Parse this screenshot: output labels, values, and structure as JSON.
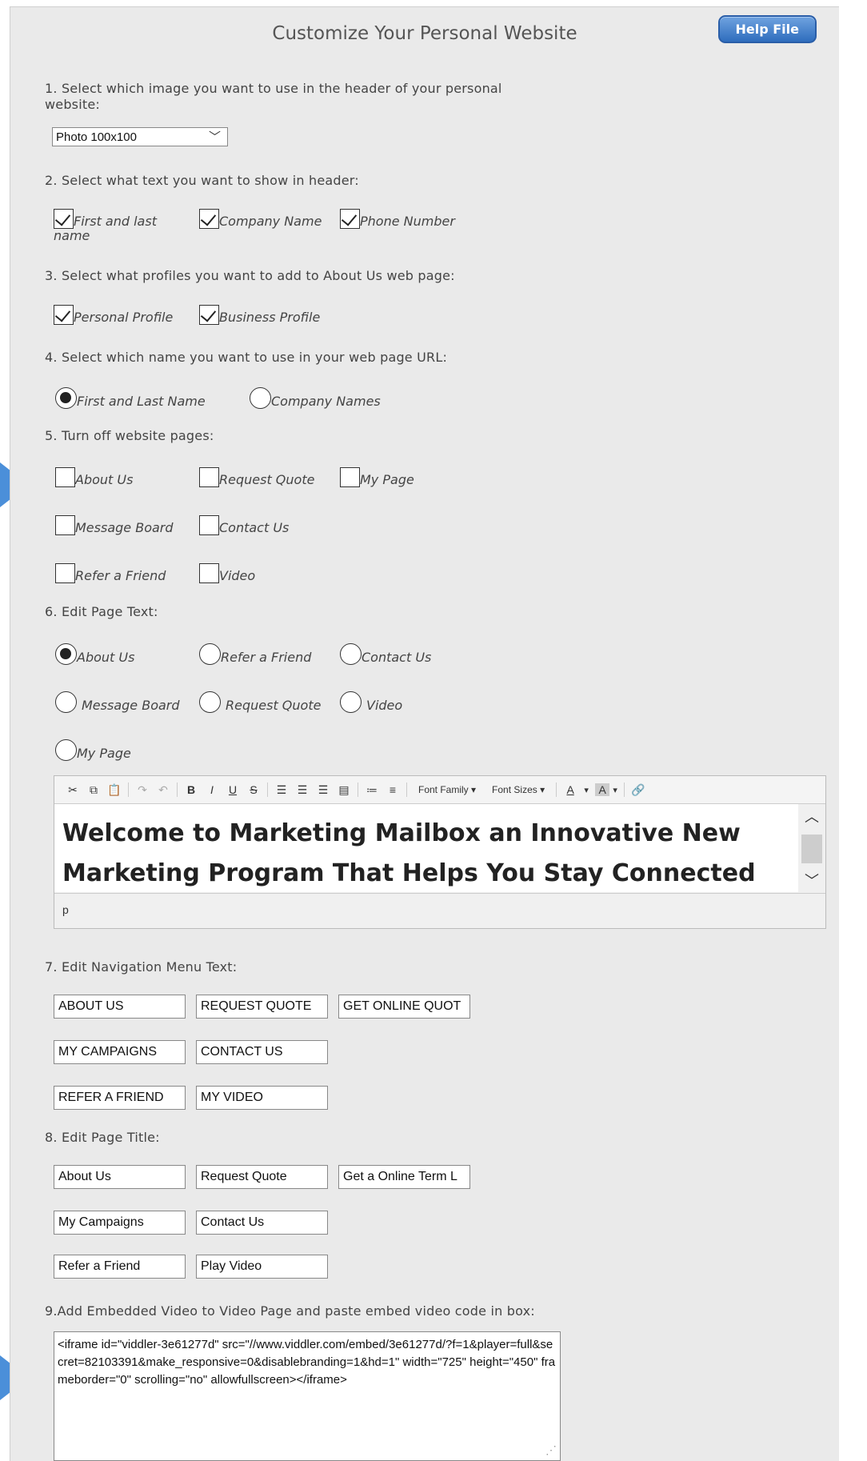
{
  "page": {
    "title": "Customize Your Personal Website",
    "help_label": "Help File"
  },
  "sections": {
    "s1": "1. Select which image you want to use in the header of your personal website:",
    "s2": "2. Select what text you want to show in header:",
    "s3": "3. Select what profiles you want to add to About Us web page:",
    "s4": "4. Select which name you want to use in your web page URL:",
    "s5": "5. Turn off website pages:",
    "s6": "6. Edit Page Text:",
    "s7": "7. Edit Navigation Menu Text:",
    "s8": "8. Edit Page Title:",
    "s9": "9.Add Embedded Video to Video Page and paste embed video code in box:"
  },
  "header_image": {
    "selected": "Photo 100x100"
  },
  "header_text": {
    "first_last": "First and last name",
    "company": "Company Name",
    "phone": "Phone Number"
  },
  "profiles": {
    "personal": "Personal Profile",
    "business": "Business Profile"
  },
  "url_name": {
    "first_last": "First and Last Name",
    "company": "Company Names"
  },
  "pages_off": {
    "about": "About Us",
    "request": "Request Quote",
    "mypage": "My Page",
    "board": "Message Board",
    "contact": "Contact Us",
    "refer": "Refer a Friend",
    "video": "Video"
  },
  "page_text": {
    "about": "About Us",
    "refer": "Refer a Friend",
    "contact": "Contact Us",
    "board": "Message Board",
    "request": "Request Quote",
    "video": "Video",
    "mypage": "My Page"
  },
  "editor": {
    "font_family": "Font Family",
    "font_sizes": "Font Sizes",
    "content": "Welcome to Marketing Mailbox an Innovative New Marketing Program That Helps You Stay Connected With",
    "path": "p"
  },
  "nav_text": {
    "about": "ABOUT US",
    "request": "REQUEST QUOTE",
    "online": "GET ONLINE QUOT",
    "campaigns": "MY CAMPAIGNS",
    "contact": "CONTACT US",
    "refer": "REFER A FRIEND",
    "video": "MY VIDEO"
  },
  "titles": {
    "about": "About Us",
    "request": "Request Quote",
    "online": "Get a Online Term L",
    "campaigns": "My Campaigns",
    "contact": "Contact Us",
    "refer": "Refer a Friend",
    "video": "Play Video"
  },
  "embed_code": "<iframe id=\"viddler-3e61277d\" src=\"//www.viddler.com/embed/3e61277d/?f=1&player=full&secret=82103391&make_responsive=0&disablebranding=1&hd=1\" width=\"725\" height=\"450\" frameborder=\"0\" scrolling=\"no\" allowfullscreen></iframe>",
  "colors": {
    "accent": "#4b8fd9",
    "button": "#2f6dbd"
  }
}
